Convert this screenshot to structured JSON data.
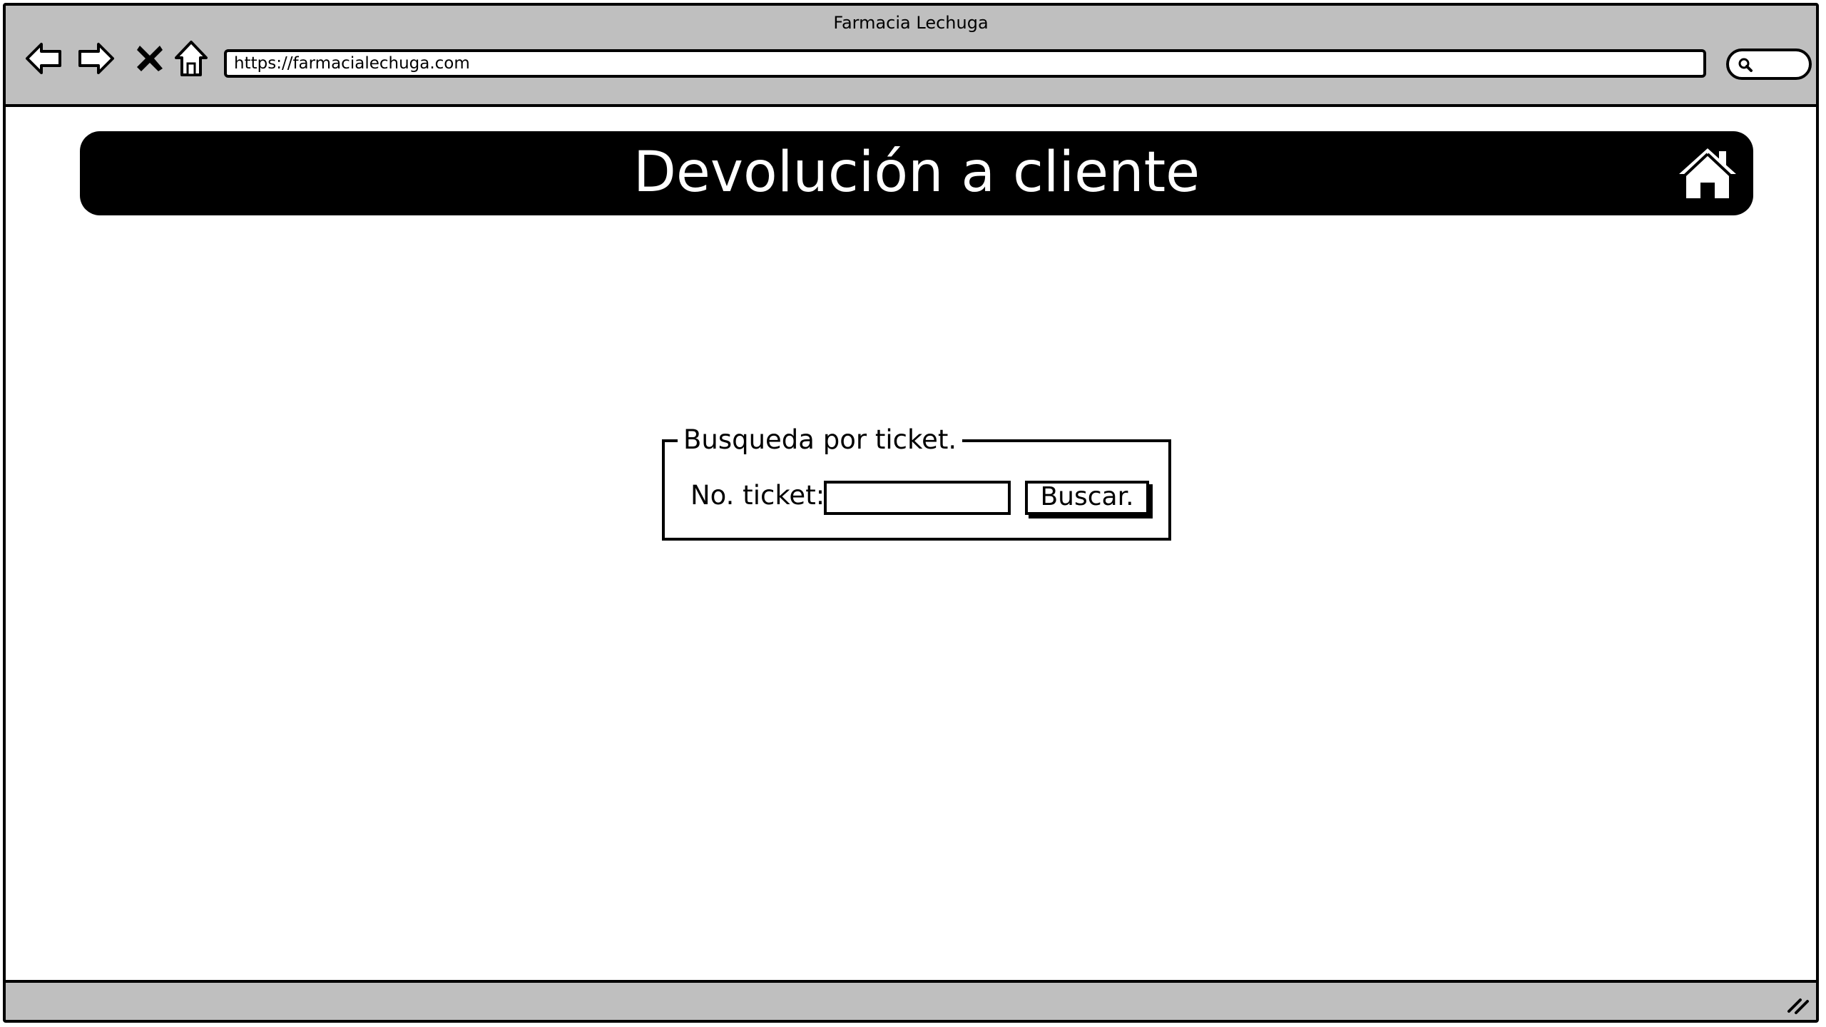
{
  "window": {
    "title": "Farmacia Lechuga"
  },
  "toolbar": {
    "back_icon": "arrow-left-icon",
    "forward_icon": "arrow-right-icon",
    "stop_icon": "close-icon",
    "home_icon": "home-icon",
    "url": "https://farmacialechuga.com",
    "search_icon": "search-icon"
  },
  "header": {
    "title": "Devolución a cliente",
    "home_icon": "home-icon",
    "background_color": "#000000",
    "text_color": "#ffffff"
  },
  "search_form": {
    "legend": "Busqueda por ticket.",
    "ticket_label": "No. ticket:",
    "ticket_value": "",
    "button_label": "Buscar."
  },
  "statusbar": {
    "resize_icon": "resize-grip-icon"
  },
  "colors": {
    "chrome": "#bfbfbf",
    "border": "#000000",
    "page": "#ffffff"
  }
}
